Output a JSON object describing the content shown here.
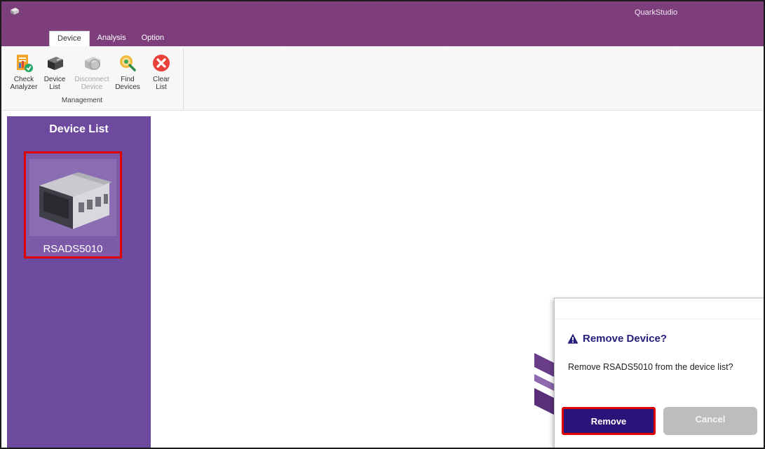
{
  "window": {
    "title": "QuarkStudio"
  },
  "tabs": [
    {
      "label": "Device",
      "active": true
    },
    {
      "label": "Analysis",
      "active": false
    },
    {
      "label": "Option",
      "active": false
    }
  ],
  "ribbon": {
    "group_label": "Management",
    "buttons": [
      {
        "label": "Check\nAnalyzer",
        "icon": "check-analyzer-icon",
        "enabled": true
      },
      {
        "label": "Device\nList",
        "icon": "device-list-icon",
        "enabled": true
      },
      {
        "label": "Disconnect\nDevice",
        "icon": "disconnect-device-icon",
        "enabled": false
      },
      {
        "label": "Find\nDevices",
        "icon": "find-devices-icon",
        "enabled": true
      },
      {
        "label": "Clear\nList",
        "icon": "clear-list-icon",
        "enabled": true
      }
    ]
  },
  "sidebar": {
    "title": "Device List",
    "devices": [
      {
        "name": "RSADS5010",
        "selected": true
      }
    ]
  },
  "dialog": {
    "title": "Remove Device?",
    "message": "Remove RSADS5010 from the device list?",
    "remove_label": "Remove",
    "cancel_label": "Cancel"
  },
  "colors": {
    "titlebar": "#7b3d7a",
    "sidebar": "#6e4a9e",
    "primary_button": "#2a1479",
    "highlight": "#e00000"
  }
}
